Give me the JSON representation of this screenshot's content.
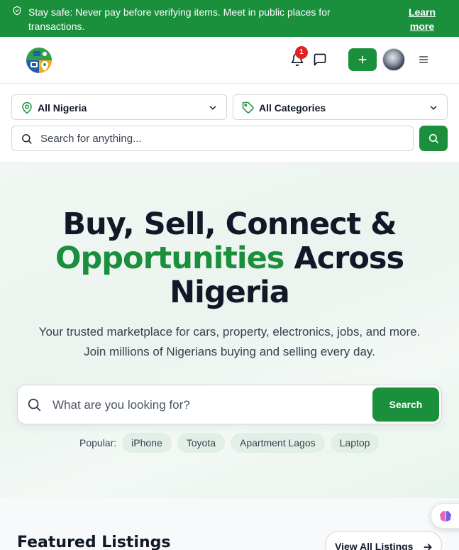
{
  "banner": {
    "text": "Stay safe: Never pay before verifying items. Meet in public places for transactions.",
    "link_label": "Learn more",
    "icon": "shield-check-icon",
    "bg_color": "#1a8f3c"
  },
  "header": {
    "logo": "marketplace-logo",
    "notifications_count": "1",
    "icons": [
      "bell-icon",
      "message-square-icon",
      "plus-icon",
      "user-avatar",
      "menu-icon"
    ]
  },
  "filters": {
    "location": "All Nigeria",
    "category": "All Categories",
    "search_placeholder": "Search for anything..."
  },
  "hero": {
    "title_line1": "Buy, Sell, Connect &",
    "title_accent": "Opportunities",
    "title_line2_rest": " Across",
    "title_line3": "Nigeria",
    "subtitle_line1": "Your trusted marketplace for cars, property, electronics, jobs, and more.",
    "subtitle_line2": "Join millions of Nigerians buying and selling every day.",
    "search_placeholder": "What are you looking for?",
    "search_button": "Search",
    "popular_label": "Popular:",
    "popular_tags": [
      "iPhone",
      "Toyota",
      "Apartment Lagos",
      "Laptop"
    ]
  },
  "featured": {
    "title": "Featured Listings",
    "view_all_label": "View All Listings"
  },
  "colors": {
    "brand_green": "#1a8f3c",
    "badge_red": "#e02424",
    "text_dark": "#111827"
  }
}
